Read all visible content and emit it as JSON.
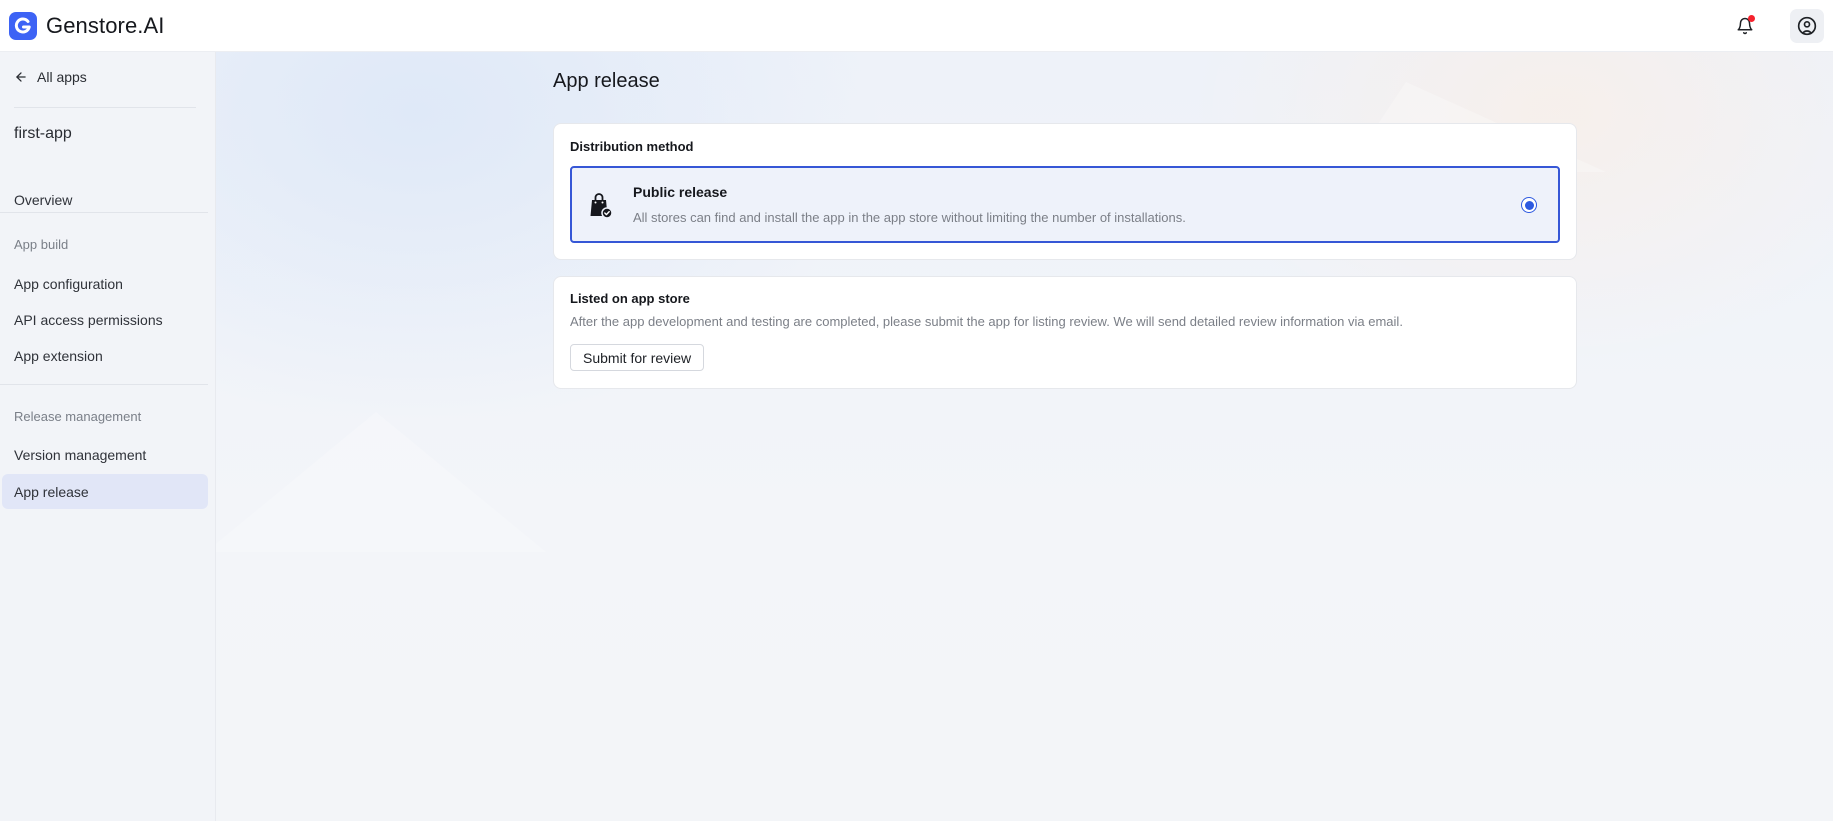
{
  "header": {
    "brand_name": "Genstore.AI",
    "brand_logo_icon": "brand-g-logo-icon",
    "notification_icon": "bell-icon",
    "user_icon": "user-circle-icon",
    "colors": {
      "brand": "#3d63f5",
      "notification_dot": "#f5222d"
    }
  },
  "sidebar": {
    "back_label": "All apps",
    "app_name": "first-app",
    "overview_label": "Overview",
    "sections": [
      {
        "label": "App build",
        "items": [
          "App configuration",
          "API access permissions",
          "App extension"
        ]
      },
      {
        "label": "Release management",
        "items": [
          "Version management",
          "App release"
        ]
      }
    ],
    "active_item": "App release"
  },
  "main": {
    "title": "App release",
    "distribution": {
      "title": "Distribution method",
      "option": {
        "title": "Public release",
        "description": "All stores can find and install the app in the app store without limiting the number of installations.",
        "icon": "shopping-bag-icon",
        "selected": true
      }
    },
    "listing": {
      "title": "Listed on app store",
      "description": "After the app development and testing are completed, please submit the app for listing review. We will send detailed review information via email.",
      "button_label": "Submit for review"
    },
    "colors": {
      "accent": "#3657d6",
      "active_nav_bg": "#e1e6f7"
    }
  }
}
